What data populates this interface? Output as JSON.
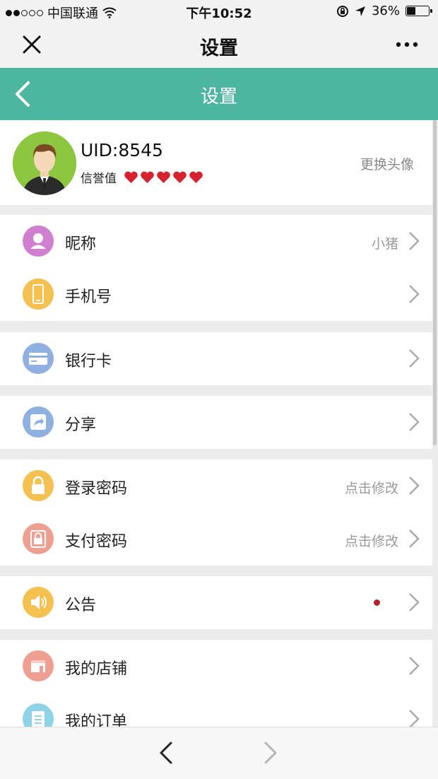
{
  "status_bar": {
    "carrier": "中国联通",
    "time": "下午10:52",
    "battery": "36%",
    "battery_level": 0.36
  },
  "wechat_bar": {
    "title": "设置"
  },
  "app_header": {
    "title": "设置"
  },
  "profile": {
    "uid": "UID:8545",
    "credit_label": "信誉值",
    "credit_hearts": 5,
    "change_avatar": "更换头像"
  },
  "menu": {
    "nickname": {
      "label": "昵称",
      "value": "小猪"
    },
    "phone": {
      "label": "手机号"
    },
    "bank_card": {
      "label": "银行卡"
    },
    "share": {
      "label": "分享"
    },
    "login_password": {
      "label": "登录密码",
      "value": "点击修改"
    },
    "pay_password": {
      "label": "支付密码",
      "value": "点击修改"
    },
    "notice": {
      "label": "公告"
    },
    "my_shop": {
      "label": "我的店铺"
    },
    "my_orders": {
      "label": "我的订单"
    }
  },
  "colors": {
    "accent": "#4db6a1",
    "nickname_icon": "#d07fd0",
    "phone_icon": "#f4c04f",
    "bank_icon": "#8fb0e0",
    "share_icon": "#8fb0e0",
    "login_icon": "#f4c04f",
    "pay_icon": "#ef9f92",
    "notice_icon": "#f4c04f",
    "shop_icon": "#ef9f92",
    "orders_icon": "#8fd3e8",
    "heart": "#d6222f"
  },
  "icons": [
    "close-icon",
    "more-icon",
    "back-arrow-icon",
    "user-icon",
    "phone-icon",
    "card-icon",
    "share-icon",
    "lock-icon",
    "speaker-icon",
    "shop-icon",
    "clipboard-icon",
    "chevron-right-icon"
  ]
}
